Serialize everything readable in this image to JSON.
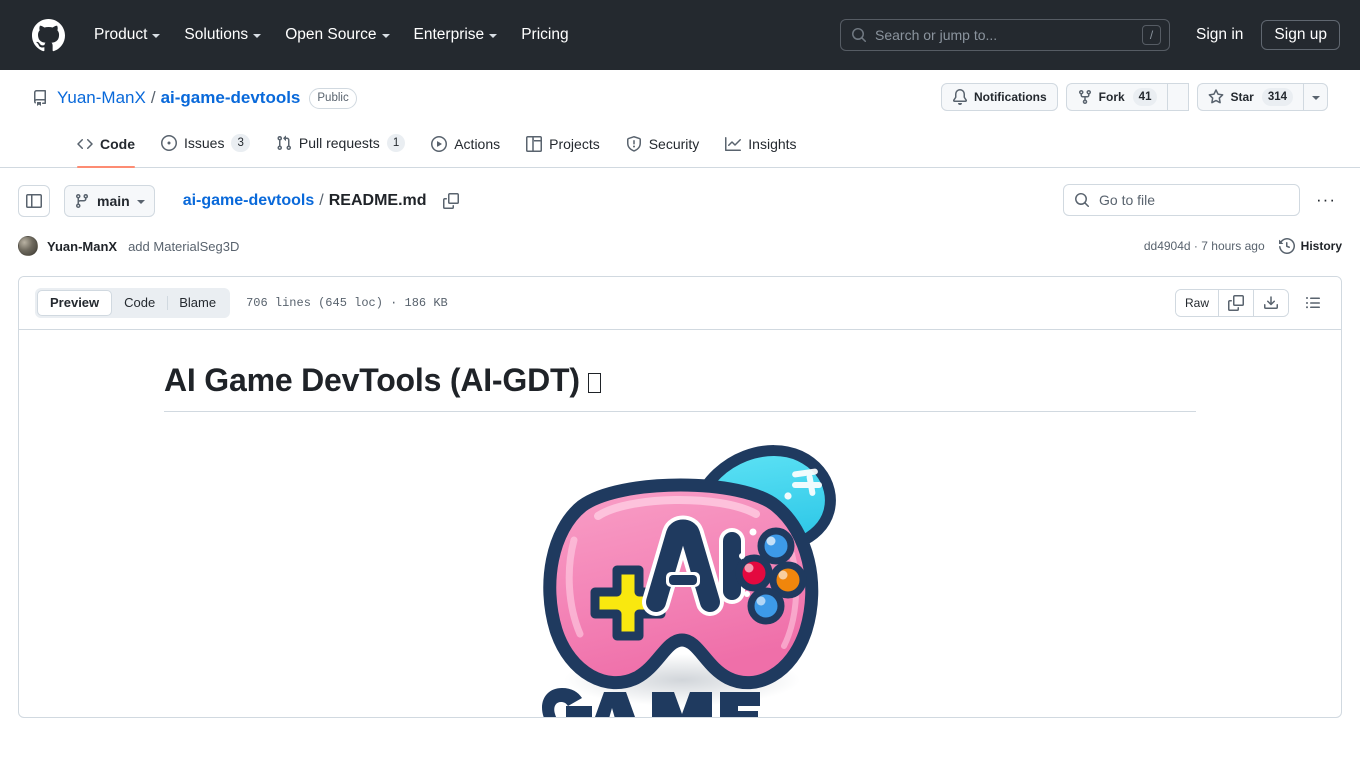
{
  "global_header": {
    "logo": "github-mark",
    "nav": [
      {
        "label": "Product",
        "has_dropdown": true
      },
      {
        "label": "Solutions",
        "has_dropdown": true
      },
      {
        "label": "Open Source",
        "has_dropdown": true
      },
      {
        "label": "Enterprise",
        "has_dropdown": true
      },
      {
        "label": "Pricing",
        "has_dropdown": false
      }
    ],
    "search": {
      "placeholder": "Search or jump to...",
      "shortcut": "/"
    },
    "sign_in": "Sign in",
    "sign_up": "Sign up",
    "bg_color": "#24292f"
  },
  "repo": {
    "owner": "Yuan-ManX",
    "separator": "/",
    "name": "ai-game-devtools",
    "visibility": "Public",
    "actions": {
      "notifications": "Notifications",
      "fork_label": "Fork",
      "fork_count": "41",
      "star_label": "Star",
      "star_count": "314"
    },
    "tabs": [
      {
        "label": "Code",
        "icon": "code-icon",
        "count": null,
        "active": true
      },
      {
        "label": "Issues",
        "icon": "issue-opened-icon",
        "count": "3",
        "active": false
      },
      {
        "label": "Pull requests",
        "icon": "git-pull-request-icon",
        "count": "1",
        "active": false
      },
      {
        "label": "Actions",
        "icon": "play-icon",
        "count": null,
        "active": false
      },
      {
        "label": "Projects",
        "icon": "table-icon",
        "count": null,
        "active": false
      },
      {
        "label": "Security",
        "icon": "shield-icon",
        "count": null,
        "active": false
      },
      {
        "label": "Insights",
        "icon": "graph-icon",
        "count": null,
        "active": false
      }
    ],
    "active_tab_underline_color": "#fd8c73"
  },
  "file_nav": {
    "branch": "main",
    "breadcrumb_repo": "ai-game-devtools",
    "breadcrumb_sep": "/",
    "breadcrumb_file": "README.md",
    "go_to_file_placeholder": "Go to file",
    "kebab": "···"
  },
  "commit": {
    "author": "Yuan-ManX",
    "message": "add MaterialSeg3D",
    "sha": "dd4904d",
    "sha_sep": "·",
    "time": "7 hours ago",
    "history_label": "History"
  },
  "file_toolbar": {
    "views": [
      {
        "label": "Preview",
        "active": true
      },
      {
        "label": "Code",
        "active": false
      },
      {
        "label": "Blame",
        "active": false
      }
    ],
    "meta": "706 lines (645 loc) · 186 KB",
    "raw_label": "Raw",
    "copy_icon": "copy-icon",
    "download_icon": "download-icon",
    "outline_icon": "list-unordered-icon"
  },
  "readme": {
    "heading": "AI Game DevTools (AI-GDT)",
    "heading_trailing_glyph": "tofu-box",
    "logo_alt": "AI Game DevTools logo — pink game controller with AI lettering",
    "logo_colors": {
      "controller_body": "#f486b8",
      "outline": "#1f3a5f",
      "blob": "#45d8ee",
      "dpad": "#f9e80f",
      "button_red": "#e4093f",
      "button_orange": "#f0860c",
      "button_blue": "#3d9ae8"
    },
    "wordmark_partial": "Game"
  }
}
